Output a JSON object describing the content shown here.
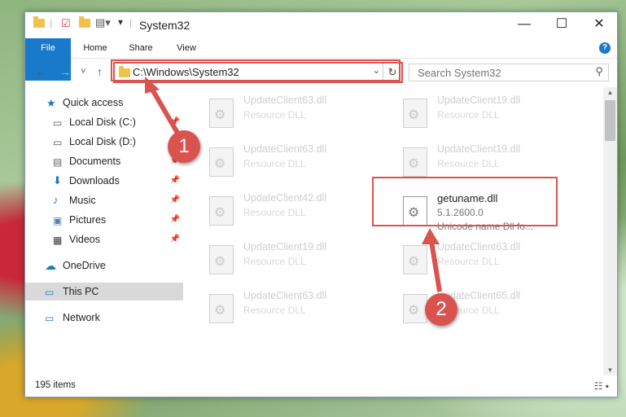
{
  "window": {
    "title": "System32"
  },
  "ribbon": {
    "tabs": [
      "File",
      "Home",
      "Share",
      "View"
    ],
    "help_icon": "?"
  },
  "nav": {
    "back": "←",
    "forward": "→",
    "recent": "˅",
    "up": "↑",
    "address": "C:\\Windows\\System32",
    "refresh": "↻",
    "search_placeholder": "Search System32"
  },
  "sidebar": {
    "items": [
      {
        "label": "Quick access",
        "icon": "star-icon",
        "pinned": false
      },
      {
        "label": "Local Disk (C:)",
        "icon": "drive-icon",
        "pinned": true
      },
      {
        "label": "Local Disk (D:)",
        "icon": "drive-icon",
        "pinned": true
      },
      {
        "label": "Documents",
        "icon": "documents-icon",
        "pinned": true
      },
      {
        "label": "Downloads",
        "icon": "download-icon",
        "pinned": true
      },
      {
        "label": "Music",
        "icon": "music-icon",
        "pinned": true
      },
      {
        "label": "Pictures",
        "icon": "pictures-icon",
        "pinned": true
      },
      {
        "label": "Videos",
        "icon": "videos-icon",
        "pinned": true
      },
      {
        "label": "OneDrive",
        "icon": "cloud-icon",
        "pinned": false
      },
      {
        "label": "This PC",
        "icon": "computer-icon",
        "pinned": false,
        "selected": true
      },
      {
        "label": "Network",
        "icon": "network-icon",
        "pinned": false
      }
    ]
  },
  "files": [
    {
      "name": "UpdateClient63.dll",
      "desc": "Resource DLL"
    },
    {
      "name": "UpdateClient19.dll",
      "desc": "Resource DLL"
    },
    {
      "name": "UpdateClient63.dll",
      "desc": "Resource DLL"
    },
    {
      "name": "UpdateClient19.dll",
      "desc": "Resource DLL"
    },
    {
      "name": "UpdateClient42.dll",
      "desc": "Resource DLL"
    },
    {
      "name": "getuname.dll",
      "version": "5.1.2600.0",
      "desc": "Unicode name Dll fo...",
      "highlighted": true
    },
    {
      "name": "UpdateClient19.dll",
      "desc": "Resource DLL"
    },
    {
      "name": "UpdateClient63.dll",
      "desc": "Resource DLL"
    },
    {
      "name": "UpdateClient63.dll",
      "desc": "Resource DLL"
    },
    {
      "name": "UpdateClient65.dll",
      "desc": "Resource DLL"
    }
  ],
  "status": {
    "count": "195 items"
  },
  "annotations": {
    "step1": "1",
    "step2": "2",
    "color": "#d9534f"
  }
}
